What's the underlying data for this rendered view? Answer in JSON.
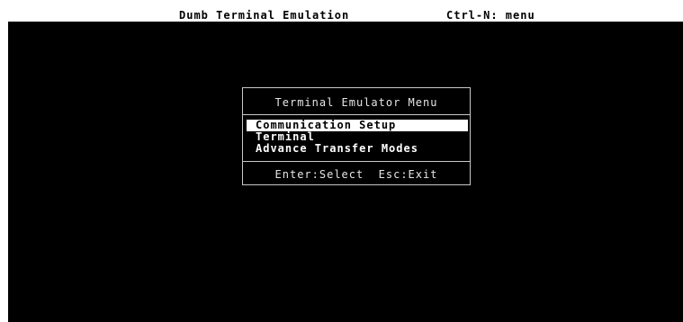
{
  "status_bar": {
    "title": "Dumb Terminal Emulation",
    "hint": "Ctrl-N: menu"
  },
  "menu": {
    "title": "Terminal Emulator Menu",
    "items": [
      {
        "label": "Communication Setup",
        "selected": true
      },
      {
        "label": "Terminal",
        "selected": false
      },
      {
        "label": "Advance Transfer Modes",
        "selected": false
      }
    ],
    "footer": "Enter:Select  Esc:Exit"
  },
  "colors": {
    "background": "#000000",
    "foreground": "#ffffff",
    "highlight_bg": "#ffffff",
    "highlight_fg": "#000000"
  }
}
